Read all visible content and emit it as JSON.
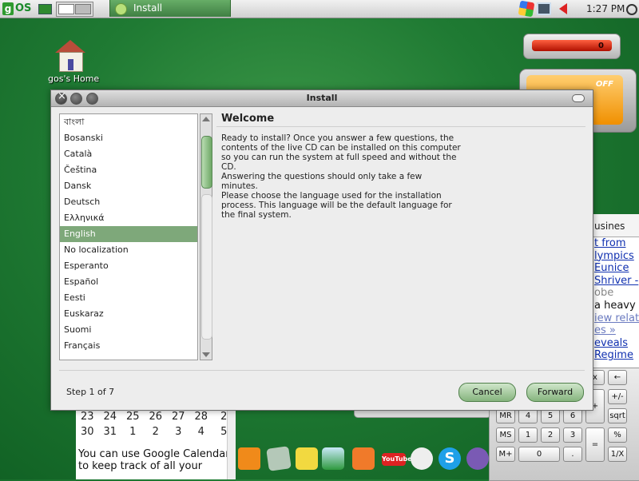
{
  "top_panel": {
    "logo": "g",
    "os_label": "OS",
    "taskbar_item": "Install",
    "clock": "1:27 PM"
  },
  "desktop": {
    "home_label": "gos's Home"
  },
  "widgets": {
    "meter_value": "0",
    "off_label": "OFF",
    "news_tab": "usines",
    "news_lines": [
      "t from",
      "lympics",
      "Eunice",
      "Shriver -",
      "obe",
      "a heavy",
      "iew relat",
      "es »",
      "eveals",
      "Regime"
    ],
    "calendar_rows": [
      [
        "23",
        "24",
        "25",
        "26",
        "27",
        "28",
        "2"
      ],
      [
        "30",
        "31",
        "1",
        "2",
        "3",
        "4",
        "5"
      ]
    ],
    "calendar_tip": "You can use Google Calendar to keep track of all your",
    "youtube_label": "YouTube",
    "skype_label": "S",
    "calculator_buttons": [
      "←",
      "+/-",
      "sqrt",
      "MR",
      "4",
      "5",
      "6",
      "+",
      "%",
      "MS",
      "1",
      "2",
      "3",
      "=",
      "1/X",
      "M+",
      "0",
      ".",
      "x",
      "÷",
      "-"
    ]
  },
  "dialog": {
    "title": "Install",
    "languages": [
      "বাংলা",
      "Bosanski",
      "Català",
      "Čeština",
      "Dansk",
      "Deutsch",
      "Ελληνικά",
      "English",
      "No localization",
      "Esperanto",
      "Español",
      "Eesti",
      "Euskaraz",
      "Suomi",
      "Français"
    ],
    "selected_language": "English",
    "welcome_title": "Welcome",
    "paragraphs": [
      "Ready to install? Once you answer a few questions, the contents of the live CD can be installed on this computer so you can run the system at full speed and without the CD.",
      "Answering the questions should only take a few minutes.",
      "Please choose the language used for the installation process. This language will be the default language for the final system."
    ],
    "step_label": "Step 1 of 7",
    "cancel_label": "Cancel",
    "forward_label": "Forward"
  },
  "colors": {
    "desktop_green": "#1f7a33",
    "selection_green": "#7ea87a",
    "button_green": "#86b47e",
    "meter_red": "#d02010",
    "off_orange": "#f09000"
  },
  "icons": [
    "gos-logo-icon",
    "show-desktop-icon",
    "workspace-switcher",
    "install-app-icon",
    "network-icon",
    "monitor-icon",
    "volume-icon",
    "power-icon",
    "home-folder-icon",
    "rss-icon",
    "newspaper-icon",
    "shopping-bag-icon",
    "photo-icon",
    "blogger-icon",
    "youtube-icon",
    "chat-bubble-icon",
    "skype-icon",
    "openoffice-icon"
  ]
}
